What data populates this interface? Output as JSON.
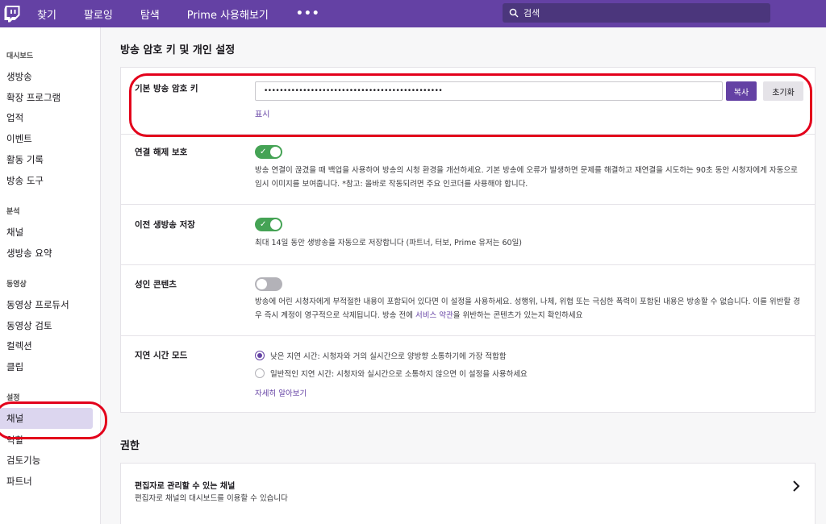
{
  "nav": {
    "items": [
      "찾기",
      "팔로잉",
      "탐색",
      "Prime 사용해보기"
    ],
    "more": "•••",
    "search_placeholder": "검색"
  },
  "sidebar": {
    "sections": [
      {
        "title": "대시보드",
        "items": [
          "생방송",
          "확장 프로그램",
          "업적",
          "이벤트",
          "활동 기록",
          "방송 도구"
        ]
      },
      {
        "title": "분석",
        "items": [
          "채널",
          "생방송 요약"
        ]
      },
      {
        "title": "동영상",
        "items": [
          "동영상 프로듀서",
          "동영상 검토",
          "컬렉션",
          "클립"
        ]
      },
      {
        "title": "설정",
        "items": [
          "채널",
          "역할",
          "검토기능",
          "파트너"
        ]
      }
    ],
    "active_item": "채널"
  },
  "main": {
    "section_title": "방송 암호 키 및 개인 설정",
    "stream_key": {
      "label": "기본 방송 암호 키",
      "value": "••••••••••••••••••••••••••••••••••••••••••••••",
      "copy_button": "복사",
      "reset_button": "초기화",
      "show_link": "표시"
    },
    "disconnect_protection": {
      "label": "연결 해제 보호",
      "enabled": true,
      "description": "방송 연결이 끊겼을 때 백업을 사용하여 방송의 시청 환경을 개선하세요. 기본 방송에 오류가 발생하면 문제를 해결하고 재연결을 시도하는 90초 동안 시청자에게 자동으로 임시 이미지를 보여줍니다. *참고: 올바로 작동되려면 주요 인코더를 사용해야 합니다."
    },
    "store_past_broadcasts": {
      "label": "이전 생방송 저장",
      "enabled": true,
      "description": "최대 14일 동안 생방송을 자동으로 저장합니다 (파트너, 터보, Prime 유저는 60일)"
    },
    "mature_content": {
      "label": "성인 콘텐츠",
      "enabled": false,
      "description_1": "방송에 어린 시청자에게 부적절한 내용이 포함되어 있다면 이 설정을 사용하세요. 성행위, 나체, 위협 또는 극심한 폭력이 포함된 내용은 방송할 수 없습니다. 이를 위반할 경우 즉시 계정이 영구적으로 삭제됩니다. 방송 전에 ",
      "description_link": "서비스 약관",
      "description_2": "을 위반하는 콘텐츠가 있는지 확인하세요"
    },
    "latency_mode": {
      "label": "지연 시간 모드",
      "options": [
        "낮은 지연 시간: 시청자와 거의 실시간으로 양방향 소통하기에 가장 적합함",
        "일반적인 지연 시간: 시청자와 실시간으로 소통하지 않으면 이 설정을 사용하세요"
      ],
      "selected_index": 0,
      "learn_more": "자세히 알아보기"
    },
    "permissions": {
      "title": "권한",
      "editor_channels_title": "편집자로 관리할 수 있는 채널",
      "editor_channels_desc": "편집자로 채널의 대시보드를 이용할 수 있습니다"
    }
  },
  "colors": {
    "brand": "#6441a4",
    "toggle_on": "#45a355",
    "annotation": "#e3001b"
  }
}
